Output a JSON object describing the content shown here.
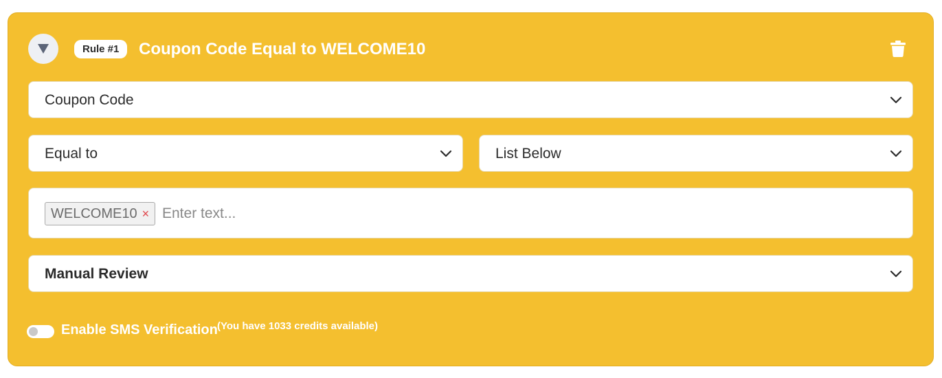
{
  "rule": {
    "badge": "Rule #1",
    "title": "Coupon Code Equal to WELCOME10"
  },
  "icons": {
    "collapse": "triangle-down-icon",
    "delete": "trash-icon",
    "dropdown": "chevron-down-icon",
    "remove_tag": "close-icon"
  },
  "fields": {
    "field_select": "Coupon Code",
    "operator_select": "Equal to",
    "source_select": "List Below",
    "action_select": "Manual Review"
  },
  "tag_input": {
    "tags": [
      "WELCOME10"
    ],
    "remove_symbol": "×",
    "placeholder": "Enter text..."
  },
  "sms": {
    "enabled": false,
    "label": "Enable SMS Verification",
    "credits": "(You have 1033 credits available)"
  },
  "colors": {
    "card_background": "#f4bf2f",
    "text_white": "#ffffff",
    "tag_remove": "#e0454b"
  }
}
